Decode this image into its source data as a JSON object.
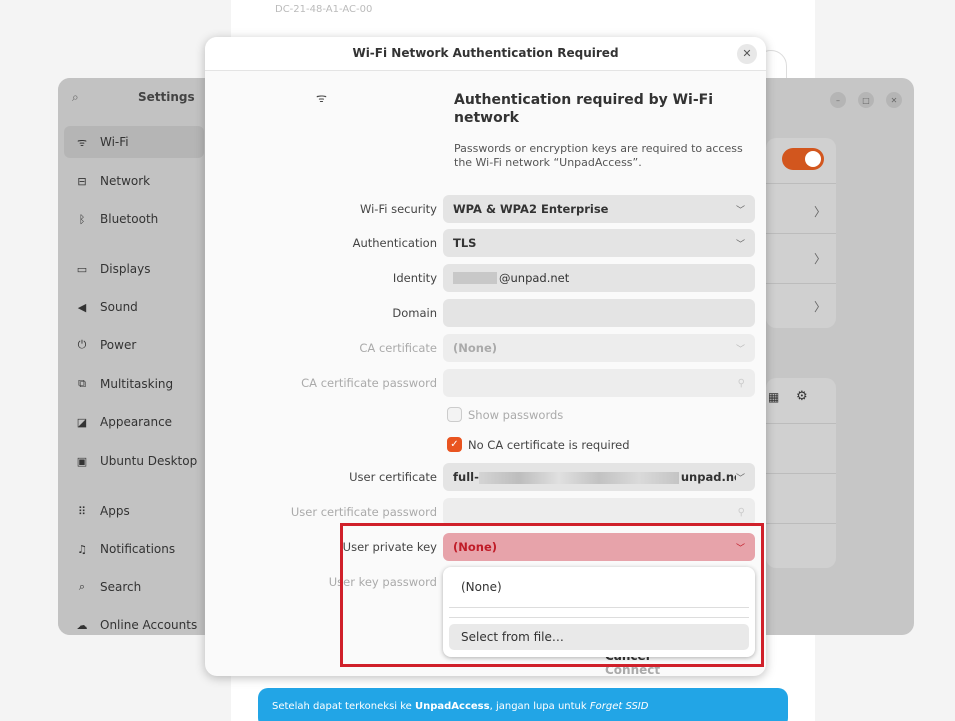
{
  "background": {
    "top_text": "DC-21-48-A1-AC-00",
    "banner": {
      "prefix": "Setelah dapat terkoneksi ke ",
      "network": "UnpadAccess",
      "middle": ", jangan lupa untuk ",
      "italic": "Forget SSID"
    }
  },
  "settings": {
    "title": "Settings",
    "search_icon": "search-icon",
    "sidebar": [
      {
        "label": "Wi-Fi",
        "icon": "wifi-icon",
        "glyph": "ᯤ"
      },
      {
        "label": "Network",
        "icon": "network-icon",
        "glyph": "⊟"
      },
      {
        "label": "Bluetooth",
        "icon": "bluetooth-icon",
        "glyph": "ᛒ"
      },
      {
        "label": "Displays",
        "icon": "display-icon",
        "glyph": "▭"
      },
      {
        "label": "Sound",
        "icon": "sound-icon",
        "glyph": "◀"
      },
      {
        "label": "Power",
        "icon": "power-icon",
        "glyph": "⏻"
      },
      {
        "label": "Multitasking",
        "icon": "multitasking-icon",
        "glyph": "⧉"
      },
      {
        "label": "Appearance",
        "icon": "appearance-icon",
        "glyph": "◪"
      },
      {
        "label": "Ubuntu Desktop",
        "icon": "ubuntu-desktop-icon",
        "glyph": "▣"
      },
      {
        "label": "Apps",
        "icon": "apps-icon",
        "glyph": "⠿"
      },
      {
        "label": "Notifications",
        "icon": "bell-icon",
        "glyph": "♫"
      },
      {
        "label": "Search",
        "icon": "search-icon",
        "glyph": "⌕"
      },
      {
        "label": "Online Accounts",
        "icon": "cloud-icon",
        "glyph": "☁"
      }
    ]
  },
  "dialog": {
    "title": "Wi-Fi Network Authentication Required",
    "heading": "Authentication required by Wi-Fi network",
    "description": "Passwords or encryption keys are required to access the Wi-Fi network “UnpadAccess”.",
    "fields": {
      "wifi_security": {
        "label": "Wi-Fi security",
        "value": "WPA & WPA2 Enterprise"
      },
      "authentication": {
        "label": "Authentication",
        "value": "TLS"
      },
      "identity": {
        "label": "Identity",
        "value": "@unpad.net"
      },
      "domain": {
        "label": "Domain",
        "value": ""
      },
      "ca_certificate": {
        "label": "CA certificate",
        "value": "(None)"
      },
      "ca_cert_password": {
        "label": "CA certificate password",
        "value": ""
      },
      "show_passwords": {
        "label": "Show passwords",
        "checked": false
      },
      "no_ca_required": {
        "label": "No CA certificate is required",
        "checked": true
      },
      "user_certificate": {
        "label": "User certificate",
        "value_prefix": "full-",
        "value_suffix": "unpad.net.crt"
      },
      "user_cert_password": {
        "label": "User certificate password",
        "value": ""
      },
      "user_private_key": {
        "label": "User private key",
        "value": "(None)"
      },
      "user_key_password": {
        "label": "User key password",
        "value": ""
      }
    },
    "buttons": {
      "cancel": "Cancel",
      "connect": "Connect"
    },
    "dropdown_options": [
      "(None)",
      "Select from file…"
    ]
  },
  "colors": {
    "accent": "#e95420",
    "highlight_box": "#d0202a",
    "banner": "#22a5e6"
  }
}
